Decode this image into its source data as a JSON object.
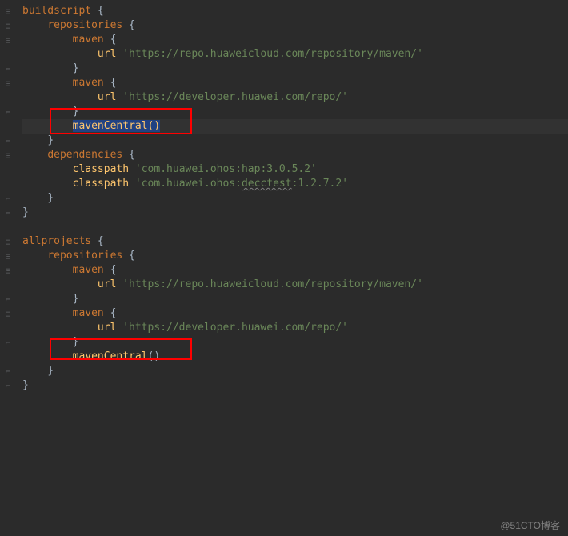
{
  "code": {
    "line1": {
      "keyword": "buildscript",
      "brace": " {"
    },
    "line2": {
      "indent": "    ",
      "keyword": "repositories",
      "brace": " {"
    },
    "line3": {
      "indent": "        ",
      "keyword": "maven",
      "brace": " {"
    },
    "line4": {
      "indent": "            ",
      "method": "url ",
      "string": "'https://repo.huaweicloud.com/repository/maven/'"
    },
    "line5": {
      "indent": "        ",
      "brace": "}"
    },
    "line6": {
      "indent": "        ",
      "keyword": "maven",
      "brace": " {"
    },
    "line7": {
      "indent": "            ",
      "method": "url ",
      "string": "'https://developer.huawei.com/repo/'"
    },
    "line8": {
      "indent": "        ",
      "brace": "}"
    },
    "line9": {
      "indent": "        ",
      "method": "mavenCentral",
      "paren": "()"
    },
    "line10": {
      "indent": "    ",
      "brace": "}"
    },
    "line11": {
      "indent": "    ",
      "keyword": "dependencies",
      "brace": " {"
    },
    "line12": {
      "indent": "        ",
      "method": "classpath ",
      "string": "'com.huawei.ohos:hap:3.0.5.2'"
    },
    "line13": {
      "indent": "        ",
      "method": "classpath ",
      "string1": "'com.huawei.ohos:",
      "underline": "decctest",
      "string2": ":1.2.7.2'"
    },
    "line14": {
      "indent": "    ",
      "brace": "}"
    },
    "line15": {
      "brace": "}"
    },
    "line16": {
      "empty": ""
    },
    "line17": {
      "keyword": "allprojects",
      "brace": " {"
    },
    "line18": {
      "indent": "    ",
      "keyword": "repositories",
      "brace": " {"
    },
    "line19": {
      "indent": "        ",
      "keyword": "maven",
      "brace": " {"
    },
    "line20": {
      "indent": "            ",
      "method": "url ",
      "string": "'https://repo.huaweicloud.com/repository/maven/'"
    },
    "line21": {
      "indent": "        ",
      "brace": "}"
    },
    "line22": {
      "indent": "        ",
      "keyword": "maven",
      "brace": " {"
    },
    "line23": {
      "indent": "            ",
      "method": "url ",
      "string": "'https://developer.huawei.com/repo/'"
    },
    "line24": {
      "indent": "        ",
      "brace": "}"
    },
    "line25": {
      "indent": "        ",
      "method": "mavenCentral",
      "paren": "()"
    },
    "line26": {
      "indent": "    ",
      "brace": "}"
    },
    "line27": {
      "brace": "}"
    }
  },
  "watermark": "@51CTO博客",
  "gutterMarks": {
    "minus": "⊟",
    "end": "⌐"
  }
}
